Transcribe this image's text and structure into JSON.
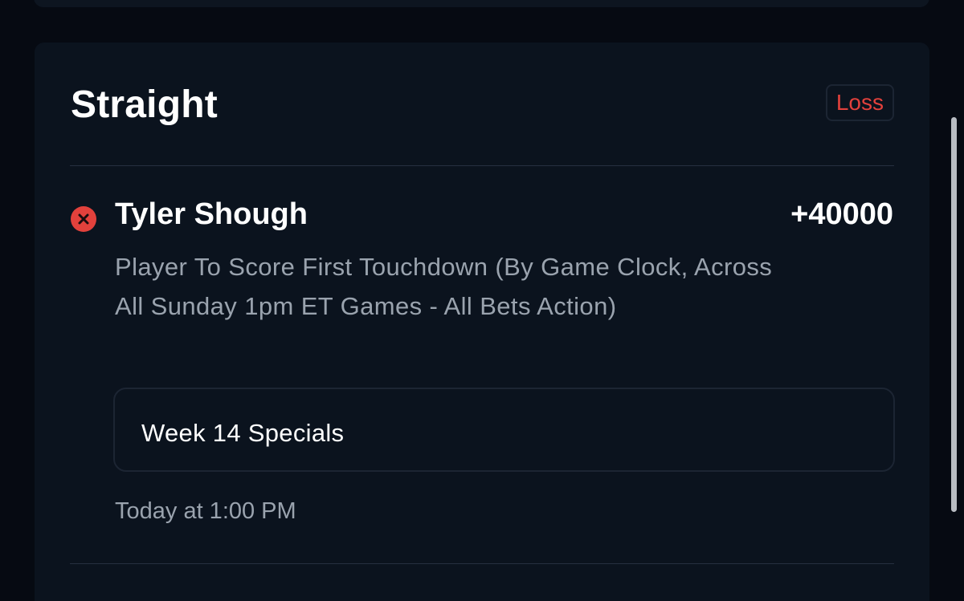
{
  "bet": {
    "type_label": "Straight",
    "status": "Loss",
    "selection": "Tyler Shough",
    "odds": "+40000",
    "market": "Player To Score First Touchdown (By Game Clock, Across All Sunday 1pm ET Games - All Bets Action)",
    "event": "Week 14 Specials",
    "time": "Today at 1:00 PM"
  },
  "colors": {
    "background": "#060a12",
    "card": "#0b131e",
    "loss": "#e2413c",
    "muted_text": "#9aa3ae"
  },
  "icons": {
    "result": "x-circle-icon"
  }
}
